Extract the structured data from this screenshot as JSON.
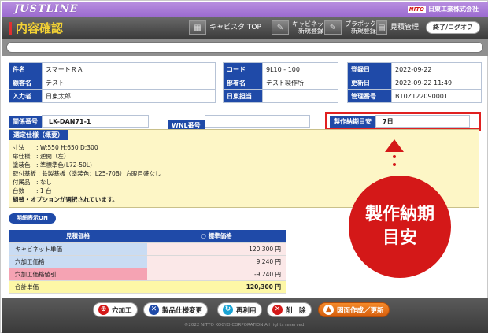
{
  "header": {
    "logo": "JUSTLINE",
    "company_brand": "NITO",
    "company_name": "日東工業株式会社",
    "page_title": "内容確認"
  },
  "nav": {
    "items": [
      {
        "label": "キャビスタ TOP"
      },
      {
        "label": "キャビネット\n新規登録"
      },
      {
        "label": "プラボックス\n新規登録"
      },
      {
        "label": "見積管理"
      }
    ],
    "logout": "終了/ログオフ"
  },
  "info": {
    "left": [
      {
        "k": "件名",
        "v": "スマートＲＡ"
      },
      {
        "k": "顧客名",
        "v": "テスト"
      },
      {
        "k": "入力者",
        "v": "日東太郎"
      }
    ],
    "mid": [
      {
        "k": "コード",
        "v": "9L10 - 100"
      },
      {
        "k": "部署名",
        "v": "テスト製作所"
      },
      {
        "k": "日東担当",
        "v": ""
      }
    ],
    "right": [
      {
        "k": "登録日",
        "v": "2022-09-22"
      },
      {
        "k": "更新日",
        "v": "2022-09-22 11:49"
      },
      {
        "k": "管理番号",
        "v": "B10Z122090001"
      }
    ]
  },
  "ref": {
    "kanren_label": "関係番号",
    "kanren_value": "LK-DAN71-1",
    "wnl_label": "WNL番号",
    "wnl_value": "",
    "lead_label": "製作納期目安",
    "lead_value": "7日"
  },
  "spec": {
    "heading": "選定仕様（概要）",
    "lines": [
      "寸法　　: W:550 H:650 D:300",
      "扉仕様　: 逆開（左）",
      "塗装色　: 準標準色(L72-50L)",
      "取付基板 : 鉄製基板（塗装色：L25-70B）方眼目盛なし",
      "付属品　: なし",
      "台数　　: 1 台"
    ],
    "note": "組替・オプションが選択されています。"
  },
  "callout": {
    "line1": "製作納期",
    "line2": "目安"
  },
  "detail_toggle": "明細表示ON",
  "price": {
    "col1": "見積価格",
    "col2": "○ 標準価格",
    "rows": [
      {
        "label": "キャビネット単価",
        "value": "120,300 円",
        "style": "blue"
      },
      {
        "label": "穴加工価格",
        "value": "9,240 円",
        "style": "blue"
      },
      {
        "label": "穴加工価格値引",
        "value": "-9,240 円",
        "style": "pink"
      },
      {
        "label": "合計単価",
        "value": "120,300 円",
        "style": "yellow"
      }
    ]
  },
  "toolbar": {
    "hole": "穴加工",
    "spec_change": "製品仕様変更",
    "reuse": "再利用",
    "delete": "削　除",
    "drawing": "図面作成／更新"
  },
  "copyright": "©2022 NITTO KOGYO CORPORATION All rights reserved."
}
